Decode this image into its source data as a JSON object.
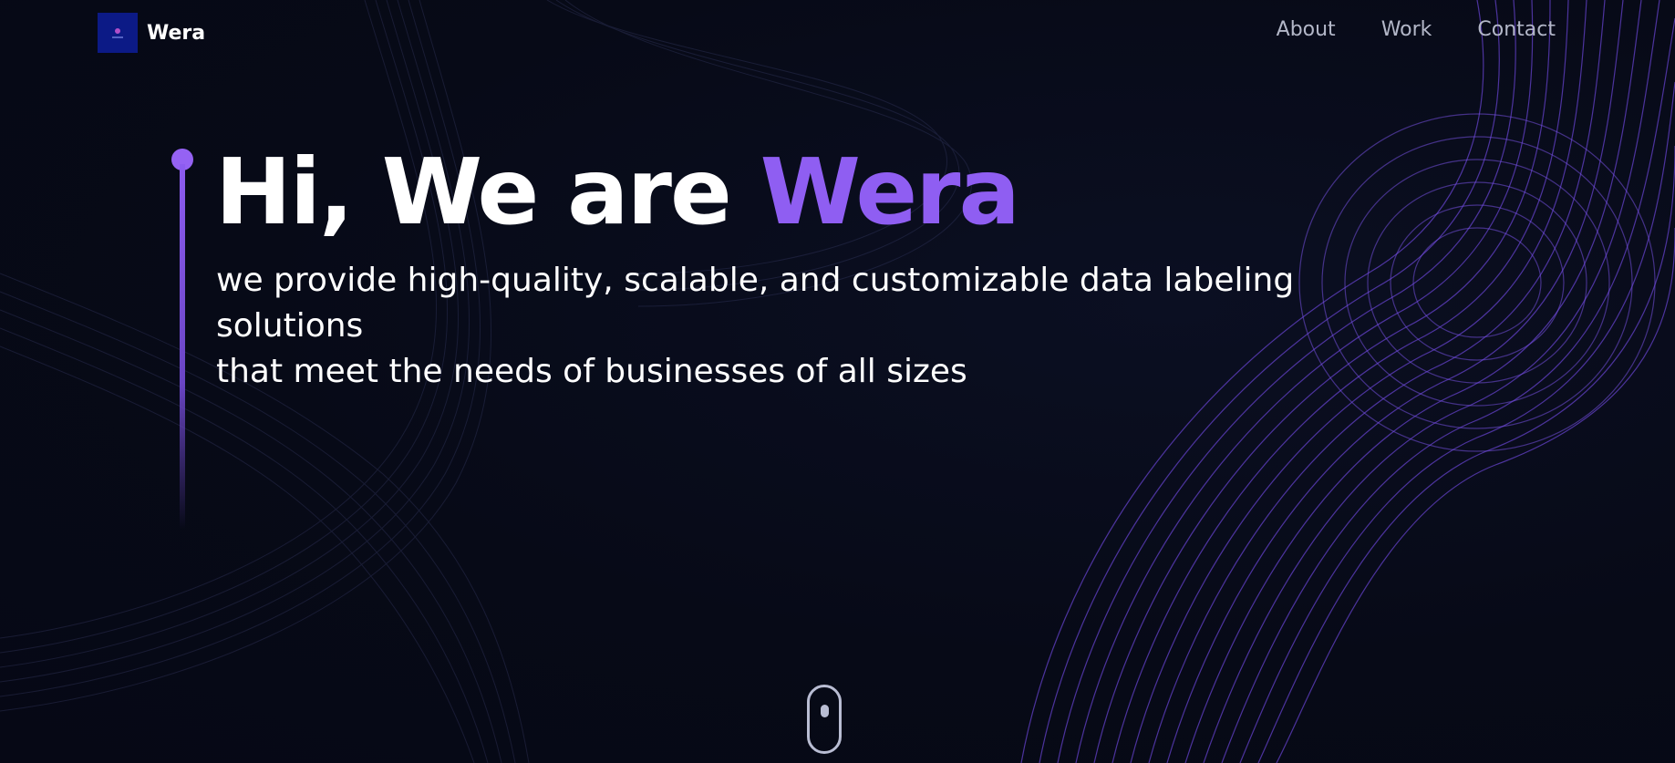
{
  "header": {
    "brand": "Wera",
    "nav": [
      {
        "label": "About"
      },
      {
        "label": "Work"
      },
      {
        "label": "Contact"
      }
    ]
  },
  "hero": {
    "title_prefix": "Hi, We are ",
    "title_accent": "Wera",
    "subtitle_line1": "we provide high-quality, scalable, and customizable data labeling solutions",
    "subtitle_line2": "that meet the needs of businesses of all sizes"
  },
  "colors": {
    "background": "#070a17",
    "accent": "#8f5ef2",
    "text": "#ffffff",
    "nav_text": "#b3b7c8",
    "logo_bg": "#0c1a86"
  },
  "icons": {
    "logo": "wera-logo-icon",
    "scroll": "scroll-mouse-icon"
  }
}
